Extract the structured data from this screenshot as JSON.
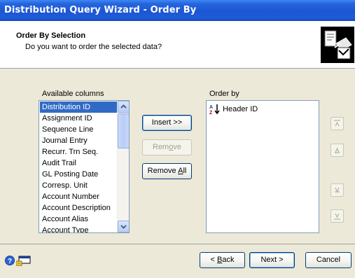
{
  "window": {
    "title": "Distribution Query Wizard - Order By"
  },
  "header": {
    "title": "Order By Selection",
    "subtitle": "Do you want to order the selected data?",
    "icon": "wizard-document-icon"
  },
  "available": {
    "label": "Available columns",
    "items": [
      "Distribution ID",
      "Assignment ID",
      "Sequence Line",
      "Journal Entry",
      "Recurr. Trn Seq.",
      "Audit Trail",
      "GL Posting Date",
      "Corresp. Unit",
      "Account Number",
      "Account Description",
      "Account Alias",
      "Account Type"
    ],
    "selected_index": 0
  },
  "actions": {
    "insert": "Insert >>",
    "remove_pre": "Rem",
    "remove_ul": "o",
    "remove_post": "ve",
    "removeall_pre": "Remove ",
    "removeall_ul": "A",
    "removeall_post": "ll"
  },
  "order_by": {
    "label": "Order by",
    "items": [
      {
        "label": "Header ID",
        "icon": "sort-ascending-az-icon"
      }
    ]
  },
  "side_buttons": [
    "move-top-icon",
    "move-up-icon",
    "move-down-icon",
    "move-bottom-icon"
  ],
  "footer": {
    "help_icon": "help-icon",
    "note_icon": "window-note-icon",
    "back_ul": "B",
    "back_pre": "< ",
    "back_post": "ack",
    "next": "Next >",
    "cancel": "Cancel"
  },
  "colors": {
    "titlebar": "#1f5bd8",
    "selection": "#316ac5",
    "window_bg": "#ece9d8"
  }
}
